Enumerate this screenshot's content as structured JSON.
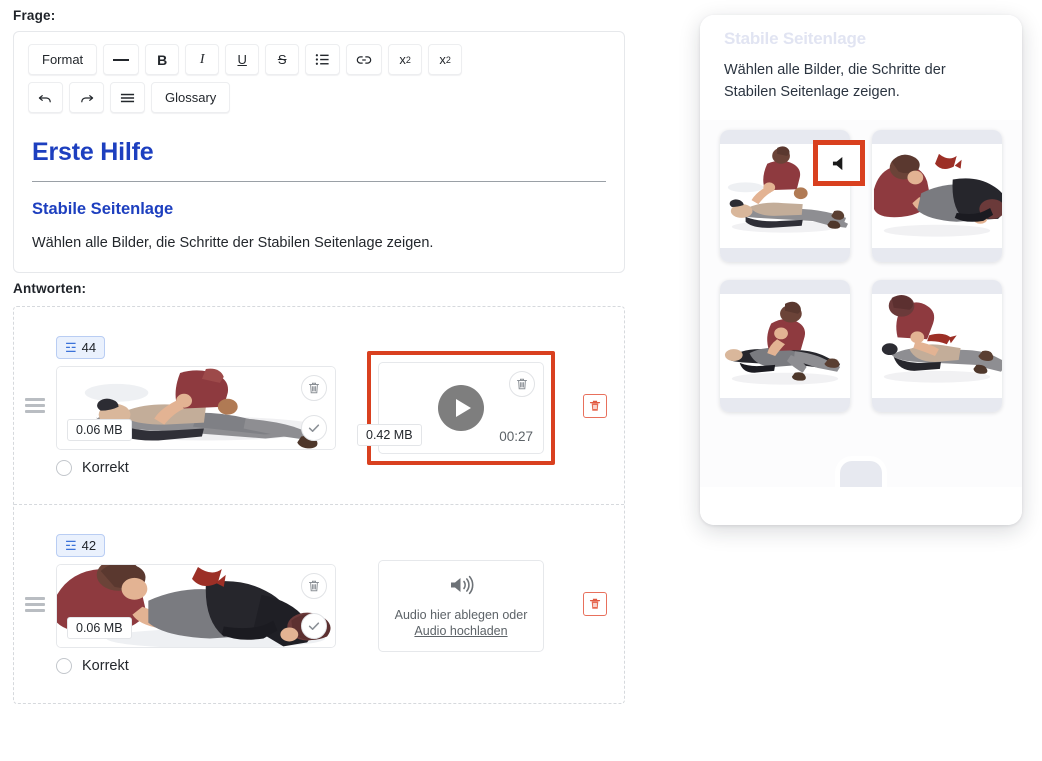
{
  "question_section": {
    "label": "Frage:",
    "toolbar": {
      "row1": [
        {
          "name": "format",
          "label": "Format"
        },
        {
          "name": "horizontal-rule",
          "label": "—"
        },
        {
          "name": "bold",
          "label": "B"
        },
        {
          "name": "italic",
          "label": "I"
        },
        {
          "name": "underline",
          "label": "U"
        },
        {
          "name": "strikethrough",
          "label": "S"
        },
        {
          "name": "bullet-list",
          "label": "≔"
        },
        {
          "name": "link",
          "label": "link"
        },
        {
          "name": "superscript",
          "label": "x2"
        },
        {
          "name": "subscript",
          "label": "x2"
        }
      ],
      "row2": [
        {
          "name": "undo",
          "label": "↰"
        },
        {
          "name": "redo",
          "label": "↱"
        },
        {
          "name": "align",
          "label": "≡"
        },
        {
          "name": "glossary",
          "label": "Glossary"
        }
      ],
      "format_label": "Format",
      "bold_label": "B",
      "italic_label": "I",
      "underline_label": "U",
      "strike_label": "S",
      "superscript_base": "x",
      "superscript_exp": "2",
      "subscript_base": "x",
      "subscript_idx": "2",
      "glossary_label": "Glossary"
    },
    "document": {
      "heading": "Erste Hilfe",
      "subheading": "Stabile Seitenlage",
      "paragraph": "Wählen alle Bilder, die Schritte der Stabilen Seitenlage zeigen."
    }
  },
  "answers_section": {
    "label": "Antworten:",
    "correct_label": "Korrekt",
    "rows": [
      {
        "id": "44",
        "image_size": "0.06 MB",
        "correct_label": "Korrekt",
        "correct_checked": false,
        "media": {
          "type": "video",
          "size": "0.42 MB",
          "duration": "00:27",
          "highlighted": true
        }
      },
      {
        "id": "42",
        "image_size": "0.06 MB",
        "correct_label": "Korrekt",
        "correct_checked": false,
        "media": {
          "type": "audio-empty",
          "drop_text": "Audio hier ablegen oder",
          "upload_link": "Audio hochladen",
          "highlighted": false
        }
      }
    ]
  },
  "preview": {
    "title": "Stabile Seitenlage",
    "subtitle": "Wählen alle Bilder, die Schritte der Stabilen Seitenlage zeigen.",
    "speaker_highlighted": true,
    "cards": [
      {
        "name": "preview-card-1"
      },
      {
        "name": "preview-card-2"
      },
      {
        "name": "preview-card-3"
      },
      {
        "name": "preview-card-4"
      }
    ]
  },
  "colors": {
    "accent_blue": "#1d3fbf",
    "highlight_red": "#d9401f",
    "delete_red": "#e8705c",
    "badge_bg": "#eaf1fd",
    "badge_border": "#b9cdf3"
  }
}
